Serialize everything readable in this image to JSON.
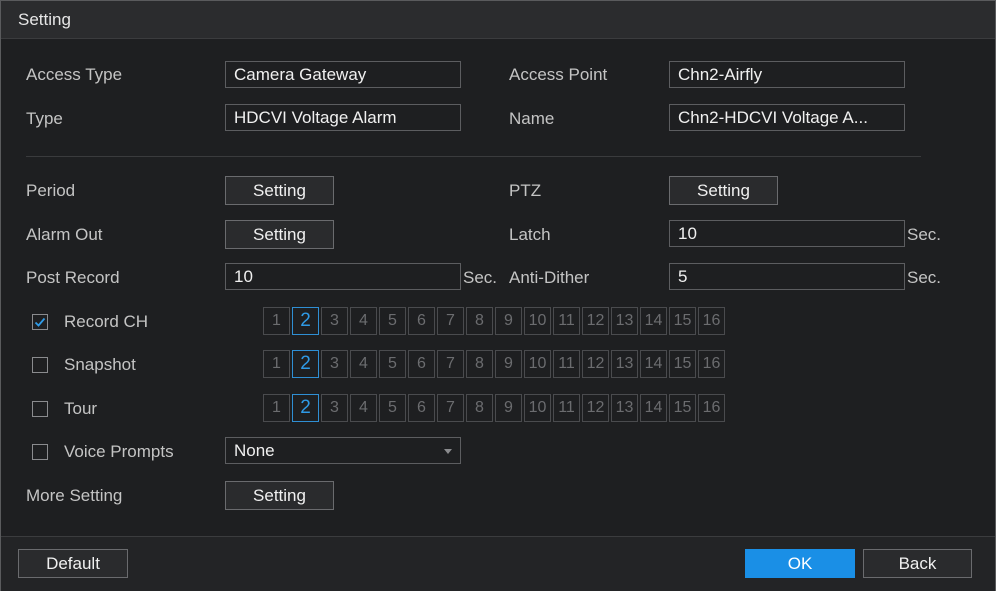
{
  "window": {
    "title": "Setting"
  },
  "form": {
    "access_type": {
      "label": "Access Type",
      "value": "Camera Gateway"
    },
    "access_point": {
      "label": "Access Point",
      "value": "Chn2-Airfly"
    },
    "type": {
      "label": "Type",
      "value": "HDCVI Voltage Alarm"
    },
    "name": {
      "label": "Name",
      "value": "Chn2-HDCVI Voltage A..."
    },
    "period": {
      "label": "Period",
      "button": "Setting"
    },
    "ptz": {
      "label": "PTZ",
      "button": "Setting"
    },
    "alarm_out": {
      "label": "Alarm Out",
      "button": "Setting"
    },
    "latch": {
      "label": "Latch",
      "value": "10",
      "unit": "Sec."
    },
    "post_record": {
      "label": "Post Record",
      "value": "10",
      "unit": "Sec."
    },
    "anti_dither": {
      "label": "Anti-Dither",
      "value": "5",
      "unit": "Sec."
    },
    "record_ch": {
      "label": "Record CH",
      "checked": true
    },
    "snapshot": {
      "label": "Snapshot",
      "checked": false
    },
    "tour": {
      "label": "Tour",
      "checked": false
    },
    "voice_prompts": {
      "label": "Voice Prompts",
      "checked": false,
      "selected": "None"
    },
    "more_setting": {
      "label": "More Setting",
      "button": "Setting"
    }
  },
  "channels": [
    "1",
    "2",
    "3",
    "4",
    "5",
    "6",
    "7",
    "8",
    "9",
    "10",
    "11",
    "12",
    "13",
    "14",
    "15",
    "16"
  ],
  "selected_channel": "2",
  "footer": {
    "default_label": "Default",
    "ok_label": "OK",
    "back_label": "Back"
  },
  "colors": {
    "accent": "#1a8fe6",
    "selected_channel": "#2f9ae6",
    "background": "#1e1f21"
  }
}
